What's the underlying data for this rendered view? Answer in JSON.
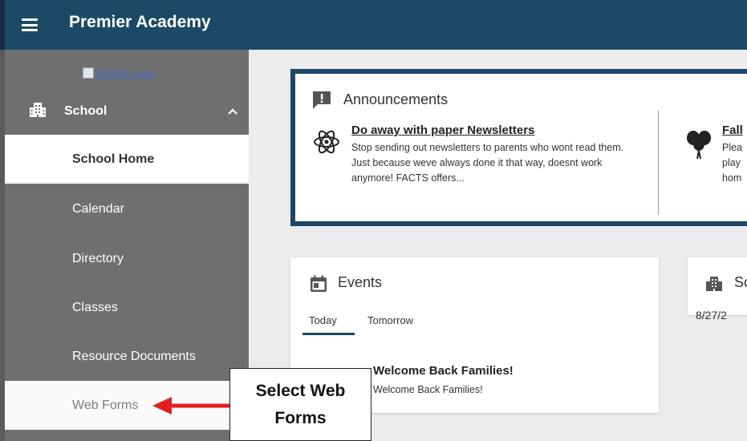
{
  "header": {
    "app_title": "Premier Academy",
    "menu_icon": "hamburger-icon"
  },
  "sidebar": {
    "logo_alt": "School Logo",
    "section": {
      "label": "School",
      "icon": "school-building-icon",
      "chevron": "chevron-up-icon"
    },
    "items": [
      {
        "label": "School Home",
        "state": "active"
      },
      {
        "label": "Calendar"
      },
      {
        "label": "Directory"
      },
      {
        "label": "Classes"
      },
      {
        "label": "Resource Documents"
      },
      {
        "label": "Web Forms",
        "state": "highlighted"
      }
    ]
  },
  "announcements": {
    "title": "Announcements",
    "items": [
      {
        "title": "Do away with paper Newsletters",
        "body": "Stop sending out newsletters to parents who wont read them. Just because weve always done it that way, doesnt work anymore! FACTS offers...",
        "icon": "atom-icon"
      },
      {
        "title": "Fall",
        "body_lines": [
          "Plea",
          "play",
          "hom"
        ],
        "icon": "balloons-icon"
      }
    ]
  },
  "events": {
    "title": "Events",
    "tabs": [
      "Today",
      "Tomorrow"
    ],
    "active_tab": "Today",
    "items": [
      {
        "title": "Welcome Back Families!",
        "body": "Welcome Back Families!"
      }
    ]
  },
  "school_card": {
    "title": "Sc",
    "date": "8/27/2"
  },
  "callout": {
    "line1": "Select Web",
    "line2": "Forms"
  },
  "colors": {
    "header": "#1c4a66",
    "sidebar": "#6f6f6f",
    "accent_border": "#1c4663",
    "arrow": "#e02020"
  }
}
